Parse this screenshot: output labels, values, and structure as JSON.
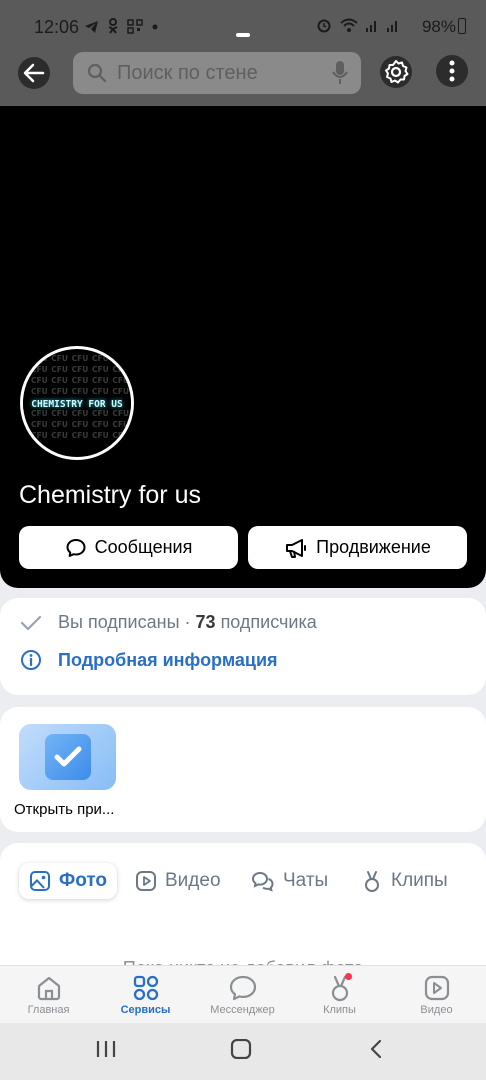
{
  "status_bar": {
    "time": "12:06",
    "left_icons": [
      "telegram-icon",
      "odnoklassniki-icon",
      "qr-icon",
      "dot-icon"
    ],
    "right_icons": [
      "alarm-icon",
      "wifi-icon",
      "signal-icon",
      "signal-icon"
    ],
    "battery": "98%"
  },
  "top_bar": {
    "search_placeholder": "Поиск по стене"
  },
  "group": {
    "name": "Chemistry for us",
    "avatar_text": "CHEMISTRY FOR US",
    "avatar_pattern": "CFU",
    "messages_label": "Сообщения",
    "promo_label": "Продвижение"
  },
  "info": {
    "subscribed_text": "Вы подписаны ·",
    "subscribers_count": "73",
    "subscribers_word": "подписчика",
    "details_label": "Подробная информация"
  },
  "app": {
    "label": "Открыть при..."
  },
  "tabs": [
    {
      "label": "Фото",
      "icon": "photo-icon",
      "active": true
    },
    {
      "label": "Видео",
      "icon": "video-icon",
      "active": false
    },
    {
      "label": "Чаты",
      "icon": "chats-icon",
      "active": false
    },
    {
      "label": "Клипы",
      "icon": "clips-icon",
      "active": false
    }
  ],
  "empty_text": "Пока никто не добавил фото",
  "bottom_nav": [
    {
      "label": "Главная",
      "icon": "home-icon",
      "active": false
    },
    {
      "label": "Сервисы",
      "icon": "services-icon",
      "active": true
    },
    {
      "label": "Мессенджер",
      "icon": "messenger-icon",
      "active": false
    },
    {
      "label": "Клипы",
      "icon": "clips-icon",
      "active": false,
      "badge": true
    },
    {
      "label": "Видео",
      "icon": "video-icon",
      "active": false
    }
  ],
  "colors": {
    "accent": "#2a6fc6",
    "cover": "#000000",
    "badge": "#ff3347"
  }
}
